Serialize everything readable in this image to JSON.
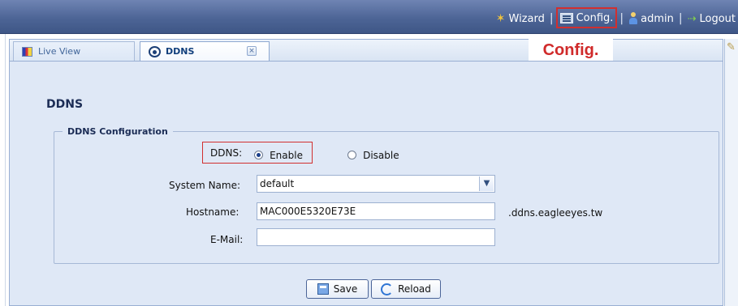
{
  "topbar": {
    "wizard": "Wizard",
    "config": "Config.",
    "user": "admin",
    "logout": "Logout"
  },
  "tabs": [
    {
      "label": "Live View"
    },
    {
      "label": "DDNS"
    }
  ],
  "annotation": {
    "config_label": "Config."
  },
  "page": {
    "title": "DDNS",
    "section": "DDNS Configuration",
    "ddns_label": "DDNS:",
    "enable_label": "Enable",
    "disable_label": "Disable",
    "system_name_label": "System Name:",
    "system_name_value": "default",
    "hostname_label": "Hostname:",
    "hostname_value": "MAC000E5320E73E",
    "hostname_suffix": ".ddns.eagleeyes.tw",
    "email_label": "E-Mail:",
    "email_value": "",
    "save_label": "Save",
    "reload_label": "Reload"
  },
  "colors": {
    "accent": "#d12f2f",
    "header": "#4d6596",
    "panel": "#dfe8f6"
  }
}
